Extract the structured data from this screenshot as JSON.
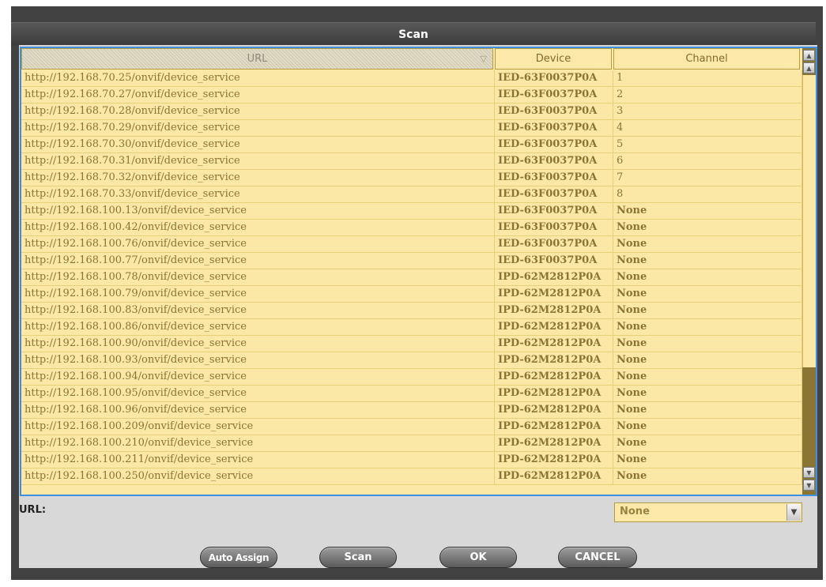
{
  "dialog": {
    "title": "Scan"
  },
  "table": {
    "headers": {
      "url": "URL",
      "device": "Device",
      "channel": "Channel"
    },
    "rows": [
      {
        "url": "http://192.168.70.25/onvif/device_service",
        "device": "IED-63F0037P0A",
        "channel": "1"
      },
      {
        "url": "http://192.168.70.27/onvif/device_service",
        "device": "IED-63F0037P0A",
        "channel": "2"
      },
      {
        "url": "http://192.168.70.28/onvif/device_service",
        "device": "IED-63F0037P0A",
        "channel": "3"
      },
      {
        "url": "http://192.168.70.29/onvif/device_service",
        "device": "IED-63F0037P0A",
        "channel": "4"
      },
      {
        "url": "http://192.168.70.30/onvif/device_service",
        "device": "IED-63F0037P0A",
        "channel": "5"
      },
      {
        "url": "http://192.168.70.31/onvif/device_service",
        "device": "IED-63F0037P0A",
        "channel": "6"
      },
      {
        "url": "http://192.168.70.32/onvif/device_service",
        "device": "IED-63F0037P0A",
        "channel": "7"
      },
      {
        "url": "http://192.168.70.33/onvif/device_service",
        "device": "IED-63F0037P0A",
        "channel": "8"
      },
      {
        "url": "http://192.168.100.13/onvif/device_service",
        "device": "IED-63F0037P0A",
        "channel": "None"
      },
      {
        "url": "http://192.168.100.42/onvif/device_service",
        "device": "IED-63F0037P0A",
        "channel": "None"
      },
      {
        "url": "http://192.168.100.76/onvif/device_service",
        "device": "IED-63F0037P0A",
        "channel": "None"
      },
      {
        "url": "http://192.168.100.77/onvif/device_service",
        "device": "IED-63F0037P0A",
        "channel": "None"
      },
      {
        "url": "http://192.168.100.78/onvif/device_service",
        "device": "IPD-62M2812P0A",
        "channel": "None"
      },
      {
        "url": "http://192.168.100.79/onvif/device_service",
        "device": "IPD-62M2812P0A",
        "channel": "None"
      },
      {
        "url": "http://192.168.100.83/onvif/device_service",
        "device": "IPD-62M2812P0A",
        "channel": "None"
      },
      {
        "url": "http://192.168.100.86/onvif/device_service",
        "device": "IPD-62M2812P0A",
        "channel": "None"
      },
      {
        "url": "http://192.168.100.90/onvif/device_service",
        "device": "IPD-62M2812P0A",
        "channel": "None"
      },
      {
        "url": "http://192.168.100.93/onvif/device_service",
        "device": "IPD-62M2812P0A",
        "channel": "None"
      },
      {
        "url": "http://192.168.100.94/onvif/device_service",
        "device": "IPD-62M2812P0A",
        "channel": "None"
      },
      {
        "url": "http://192.168.100.95/onvif/device_service",
        "device": "IPD-62M2812P0A",
        "channel": "None"
      },
      {
        "url": "http://192.168.100.96/onvif/device_service",
        "device": "IPD-62M2812P0A",
        "channel": "None"
      },
      {
        "url": "http://192.168.100.209/onvif/device_service",
        "device": "IPD-62M2812P0A",
        "channel": "None"
      },
      {
        "url": "http://192.168.100.210/onvif/device_service",
        "device": "IPD-62M2812P0A",
        "channel": "None"
      },
      {
        "url": "http://192.168.100.211/onvif/device_service",
        "device": "IPD-62M2812P0A",
        "channel": "None"
      },
      {
        "url": "http://192.168.100.250/onvif/device_service",
        "device": "IPD-62M2812P0A",
        "channel": "None"
      }
    ]
  },
  "url_field": {
    "label": "URL:",
    "selected": "None"
  },
  "buttons": {
    "auto_assign": "Auto Assign",
    "scan": "Scan",
    "ok": "OK",
    "cancel": "CANCEL"
  },
  "icons": {
    "sort": "sort-desc-icon",
    "scroll_up": "scroll-up-icon",
    "scroll_down": "scroll-down-icon",
    "dropdown": "chevron-down-icon"
  },
  "colors": {
    "dialog_bg": "#424242",
    "table_bg": "#fbe7a6",
    "table_text": "#8c7434",
    "selection_border": "#3e8fe0",
    "scrollbar_track": "#8a7534",
    "button_gray": "#7a7a7a"
  }
}
